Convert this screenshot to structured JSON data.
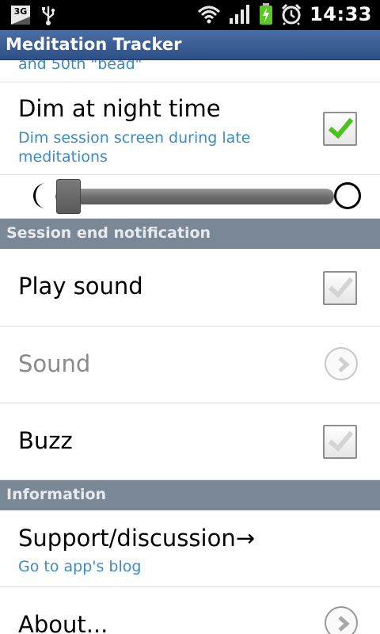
{
  "status_bar": {
    "network": "3G",
    "time": "14:33",
    "icons": [
      "3g-icon",
      "usb-icon",
      "wifi-icon",
      "signal-icon",
      "battery-charging-icon",
      "alarm-icon"
    ]
  },
  "app_title": "Meditation Tracker",
  "colors": {
    "title_bar": "#3a5d94",
    "section_header": "#7a8896",
    "summary_text": "#3c8ac8",
    "check_green": "#4cc21e"
  },
  "cut_off_summary": "and 50th \"bead\"",
  "dim_at_night": {
    "title": "Dim at night time",
    "summary": "Dim session screen during late meditations",
    "checked": true
  },
  "brightness_slider": {
    "left_icon": "moon-icon",
    "right_icon": "sun-icon",
    "level": 0.05
  },
  "sections": {
    "session_end": "Session end notification",
    "information": "Information"
  },
  "play_sound": {
    "title": "Play sound",
    "checked": true
  },
  "sound": {
    "title": "Sound",
    "enabled": false
  },
  "buzz": {
    "title": "Buzz",
    "checked": true
  },
  "support": {
    "title": "Support/discussion→",
    "summary": "Go to app's blog"
  },
  "about": {
    "title": "About..."
  }
}
